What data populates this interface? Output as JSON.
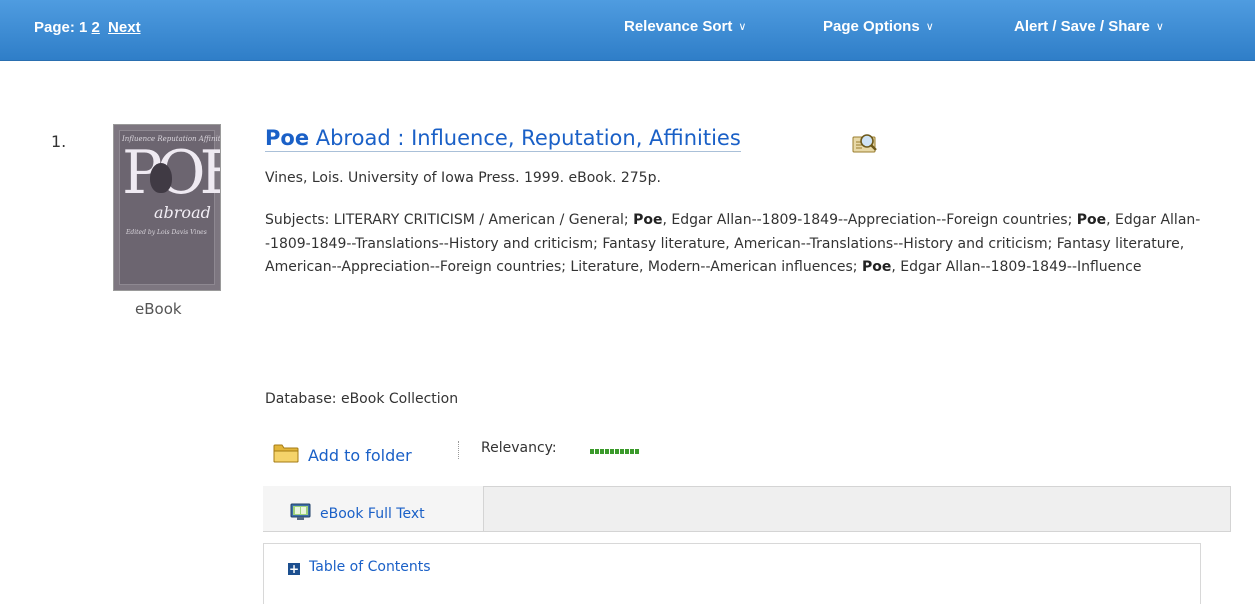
{
  "toolbar": {
    "page_label": "Page: 1",
    "page_2": "2",
    "next": "Next",
    "relevance_sort": "Relevance Sort",
    "page_options": "Page Options",
    "alert_save_share": "Alert / Save / Share",
    "chevron_icon": "chevron-down-icon"
  },
  "result": {
    "number": "1.",
    "cover_text_top": "Influence Reputation Affinities",
    "cover_big": "POE",
    "cover_sub": "abroad",
    "cover_editor": "Edited by Lois Davis Vines",
    "type_label": "eBook",
    "title_highlight": "Poe",
    "title_rest": " Abroad : Influence, Reputation, Affinities",
    "byline": "Vines, Lois. University of Iowa Press. 1999. eBook. 275p.",
    "subjects": {
      "p1": "Subjects: LITERARY CRITICISM / American / General; ",
      "poe1": "Poe",
      "p2": ", Edgar Allan--1809-1849--Appreciation--Foreign countries; ",
      "poe2": "Poe",
      "p3": ", Edgar Allan--1809-1849--Translations--History and criticism; Fantasy literature, American--Translations--History and criticism; Fantasy literature, American--Appreciation--Foreign countries; Literature, Modern--American influences; ",
      "poe3": "Poe",
      "p4": ", Edgar Allan--1809-1849--Influence"
    },
    "database": "Database: eBook Collection",
    "add_to_folder": "Add to folder",
    "relevancy_label": "Relevancy:",
    "relevancy_fraction": 1.0,
    "fulltext_label": "eBook Full Text",
    "toc_label": "Table of Contents"
  },
  "colors": {
    "toolbar": "#2f7ec8",
    "link": "#1a60c7",
    "relevancy": "#3a9a2a"
  }
}
